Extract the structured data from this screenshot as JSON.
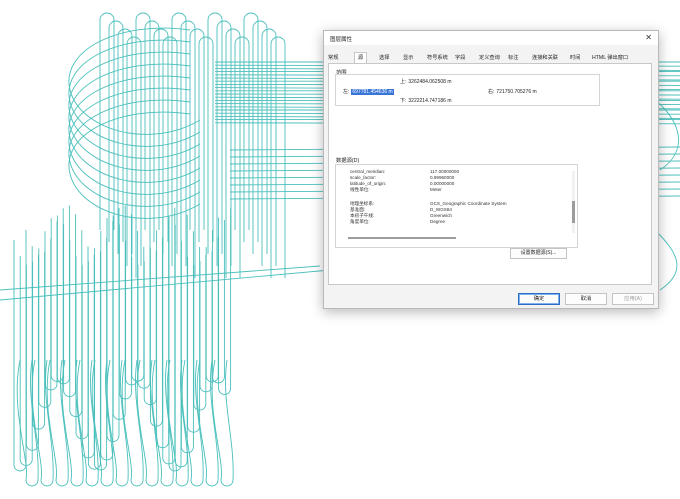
{
  "dialog": {
    "title": "图层属性",
    "close_glyph": "✕",
    "tabs": [
      "常规",
      "源",
      "选择",
      "显示",
      "符号系统",
      "字段",
      "定义查询",
      "标注",
      "连接和关联",
      "时间",
      "HTML 弹出窗口"
    ],
    "active_tab_index": 1
  },
  "extent": {
    "label": "范围",
    "top_label": "上:",
    "top_value": "3262484.062508 m",
    "left_label": "左:",
    "left_value": "697781.454636 m",
    "right_label": "右:",
    "right_value": "721750.705276 m",
    "bottom_label": "下:",
    "bottom_value": "3222214.747186 m"
  },
  "data_source": {
    "label": "数据源(D)",
    "rows": [
      {
        "key": "central_meridian:",
        "value": "117.00000000"
      },
      {
        "key": "scale_factor:",
        "value": "0.99960000"
      },
      {
        "key": "latitude_of_origin:",
        "value": "0.00000000"
      },
      {
        "key": "线性单位:",
        "value": "Meter"
      },
      {
        "key": "地理坐标系:",
        "value": "GCS_Geographic Coordinate System"
      },
      {
        "key": "基准面:",
        "value": "D_WGS84"
      },
      {
        "key": "本初子午线:",
        "value": "Greenwich"
      },
      {
        "key": "角度单位:",
        "value": "Degree"
      }
    ],
    "set_source_button": "设置数据源(S)..."
  },
  "buttons": {
    "ok": "确定",
    "cancel": "取消",
    "apply": "应用(A)"
  },
  "colors": {
    "track": "#2bb5b0",
    "accent": "#3875d7"
  }
}
